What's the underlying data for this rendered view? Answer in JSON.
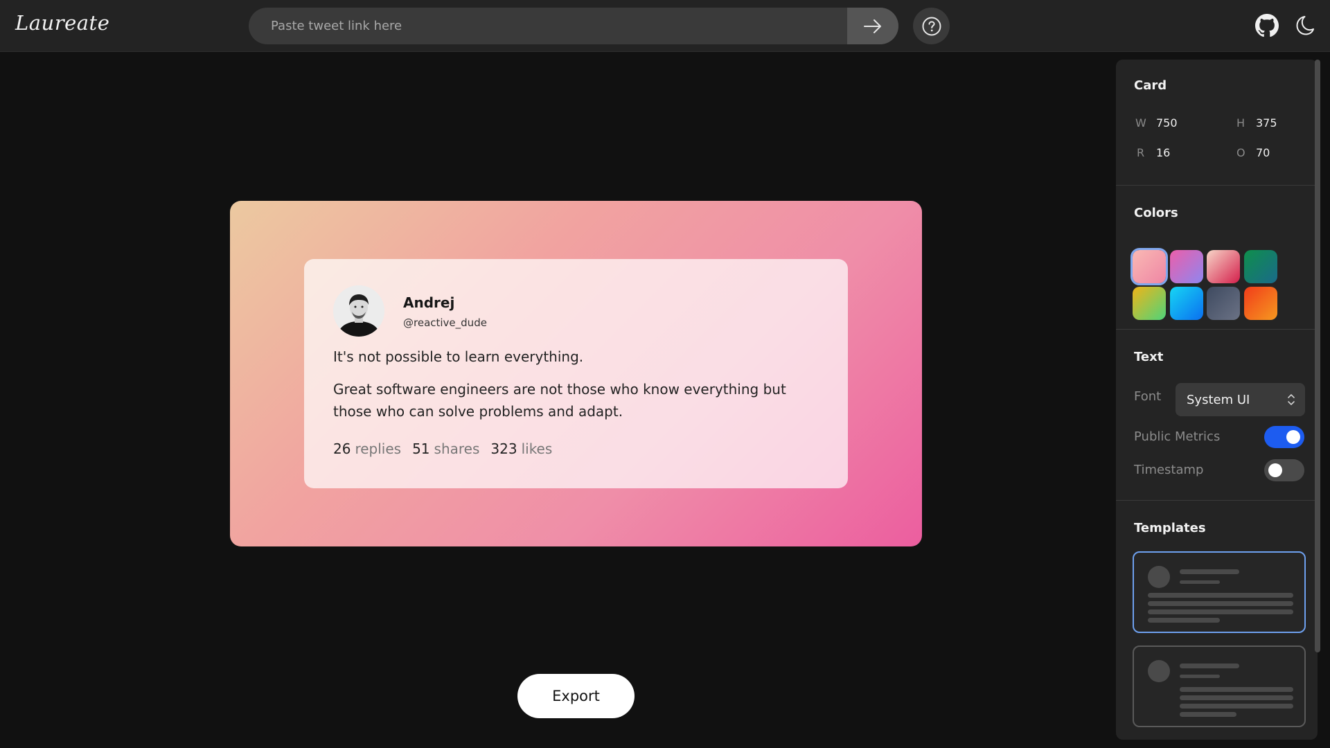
{
  "app": {
    "logo": "Laureate"
  },
  "search": {
    "placeholder": "Paste tweet link here",
    "submit_icon": "arrow-right-icon"
  },
  "header": {
    "help_icon": "help-circle-icon",
    "github_icon": "github-icon",
    "theme_icon": "moon-icon"
  },
  "tweet": {
    "author": "Andrej",
    "handle": "@reactive_dude",
    "paragraphs": [
      "It's not possible to learn everything.",
      "Great software engineers are not those who know everything but those who can solve problems and adapt."
    ],
    "metrics": {
      "replies_count": "26",
      "replies_label": "replies",
      "shares_count": "51",
      "shares_label": "shares",
      "likes_count": "323",
      "likes_label": "likes"
    }
  },
  "export_label": "Export",
  "panel": {
    "card": {
      "title": "Card",
      "w_label": "W",
      "w_value": "750",
      "h_label": "H",
      "h_value": "375",
      "r_label": "R",
      "r_value": "16",
      "o_label": "O",
      "o_value": "70"
    },
    "colors": {
      "title": "Colors",
      "swatches": [
        {
          "from": "#f9b9b4",
          "to": "#ef86a4",
          "selected": true
        },
        {
          "from": "#ec5ea9",
          "to": "#8f86ef",
          "selected": false
        },
        {
          "from": "#f7d6c8",
          "to": "#d41f4b",
          "selected": false
        },
        {
          "from": "#0f8f4b",
          "to": "#1a6a8a",
          "selected": false
        },
        {
          "from": "#f0b419",
          "to": "#4ed47a",
          "selected": false
        },
        {
          "from": "#17d6f4",
          "to": "#0a6ff0",
          "selected": false
        },
        {
          "from": "#3e4a60",
          "to": "#6b7285",
          "selected": false
        },
        {
          "from": "#f13c1a",
          "to": "#f69920",
          "selected": false
        }
      ]
    },
    "text": {
      "title": "Text",
      "font_label": "Font",
      "font_value": "System UI",
      "public_metrics_label": "Public Metrics",
      "public_metrics_on": true,
      "timestamp_label": "Timestamp",
      "timestamp_on": false
    },
    "templates": {
      "title": "Templates",
      "selected_index": 0
    }
  },
  "accent_color": "#1d5cf0"
}
